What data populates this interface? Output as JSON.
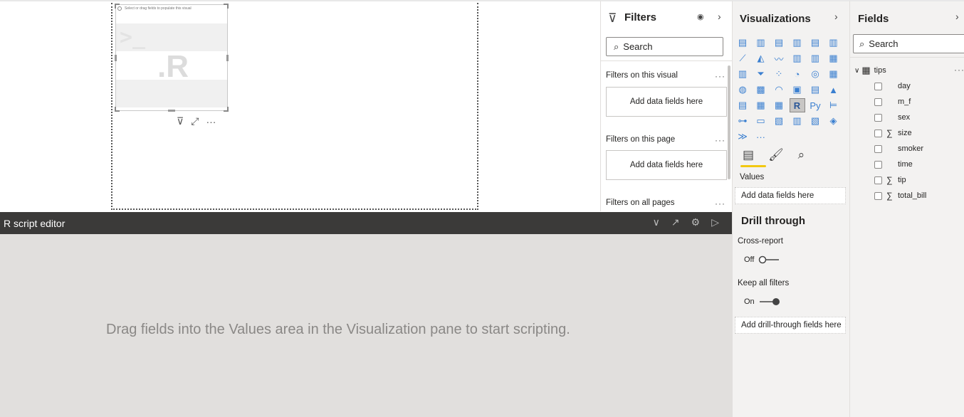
{
  "canvas": {
    "visual_hint": "Select or drag fields to populate this visual",
    "prompt_glyph": ">_",
    "r_label": ".R",
    "toolbar": {
      "filter": "⊽",
      "focus": "⤢",
      "more": "···"
    }
  },
  "filters": {
    "title": "Filters",
    "search_placeholder": "Search",
    "sections": [
      {
        "label": "Filters on this visual",
        "well": "Add data fields here"
      },
      {
        "label": "Filters on this page",
        "well": "Add data fields here"
      },
      {
        "label": "Filters on all pages"
      }
    ]
  },
  "visualizations": {
    "title": "Visualizations",
    "selected": "R script visual",
    "values_label": "Values",
    "values_well": "Add data fields here",
    "drill_title": "Drill through",
    "cross_report": {
      "label": "Cross-report",
      "state": "Off"
    },
    "keep_filters": {
      "label": "Keep all filters",
      "state": "On"
    },
    "drill_well": "Add drill-through fields here",
    "icons": [
      "stacked-bar",
      "stacked-column",
      "clustered-bar",
      "clustered-column",
      "100-stacked-bar",
      "100-stacked-column",
      "line",
      "area",
      "stacked-area",
      "line-clustered-column",
      "line-stacked-column",
      "ribbon",
      "waterfall",
      "funnel",
      "scatter",
      "pie",
      "donut",
      "treemap",
      "map",
      "filled-map",
      "gauge",
      "card",
      "multi-row-card",
      "kpi",
      "slicer",
      "table",
      "matrix",
      "r-script",
      "python",
      "key-influencers",
      "decomposition-tree",
      "qa",
      "paginated",
      "smart-narrative",
      "power-apps",
      "power-automate-diamond",
      "power-automate",
      "more"
    ],
    "glyphs": [
      "▤",
      "▥",
      "▤",
      "▥",
      "▤",
      "▥",
      "⟋",
      "◭",
      "〰",
      "▥",
      "▥",
      "▦",
      "▥",
      "⏷",
      "⁘",
      "◔",
      "◎",
      "▦",
      "◍",
      "▩",
      "◠",
      "▣",
      "▤",
      "▲",
      "▤",
      "▦",
      "▦",
      "R",
      "Py",
      "⊨",
      "⊶",
      "▭",
      "▧",
      "▥",
      "▧",
      "◈",
      "≫",
      "···"
    ]
  },
  "fields": {
    "title": "Fields",
    "search_placeholder": "Search",
    "table": "tips",
    "items": [
      {
        "name": "day",
        "sum": ""
      },
      {
        "name": "m_f",
        "sum": ""
      },
      {
        "name": "sex",
        "sum": ""
      },
      {
        "name": "size",
        "sum": "∑"
      },
      {
        "name": "smoker",
        "sum": ""
      },
      {
        "name": "time",
        "sum": ""
      },
      {
        "name": "tip",
        "sum": "∑"
      },
      {
        "name": "total_bill",
        "sum": "∑"
      }
    ]
  },
  "editor": {
    "title": "R script editor",
    "message": "Drag fields into the Values area in the Visualization pane to start scripting."
  }
}
